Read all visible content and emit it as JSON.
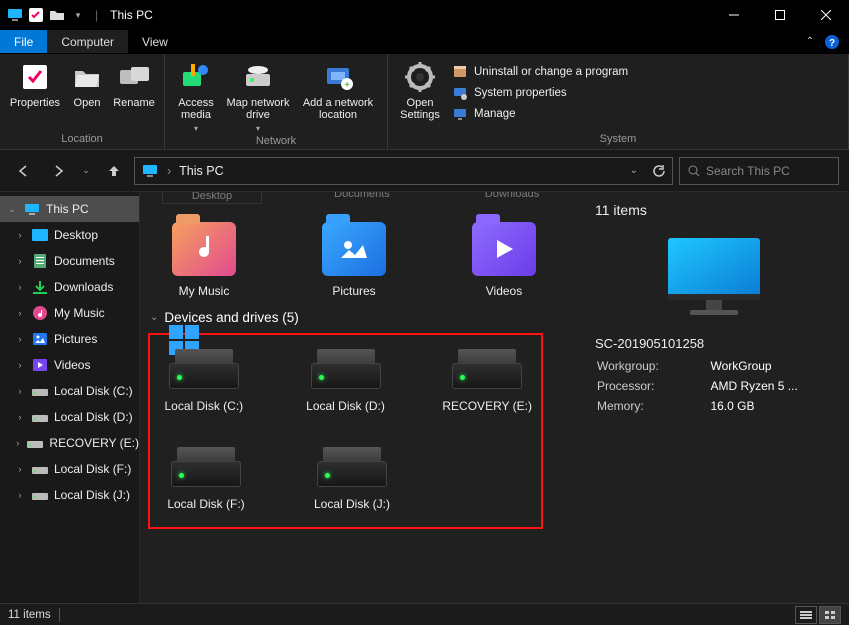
{
  "window": {
    "title": "This PC"
  },
  "menu": {
    "file": "File",
    "computer": "Computer",
    "view": "View"
  },
  "ribbon": {
    "location": {
      "label": "Location",
      "properties": "Properties",
      "open": "Open",
      "rename": "Rename"
    },
    "network": {
      "label": "Network",
      "access_media": "Access media",
      "map_drive": "Map network drive",
      "add_location": "Add a network location"
    },
    "system": {
      "label": "System",
      "open_settings": "Open Settings",
      "uninstall": "Uninstall or change a program",
      "sysprops": "System properties",
      "manage": "Manage"
    }
  },
  "address": {
    "path": "This PC",
    "sep": "›"
  },
  "search": {
    "placeholder": "Search This PC"
  },
  "sidebar": {
    "root": "This PC",
    "items": [
      "Desktop",
      "Documents",
      "Downloads",
      "My Music",
      "Pictures",
      "Videos",
      "Local Disk (C:)",
      "Local Disk (D:)",
      "RECOVERY (E:)",
      "Local Disk (F:)",
      "Local Disk (J:)"
    ]
  },
  "cutoff": [
    "Desktop",
    "Documents",
    "Downloads"
  ],
  "folders": [
    {
      "label": "My Music",
      "kind": "music"
    },
    {
      "label": "Pictures",
      "kind": "pics"
    },
    {
      "label": "Videos",
      "kind": "vids"
    }
  ],
  "drives_header": "Devices and drives (5)",
  "drives": [
    {
      "label": "Local Disk (C:)",
      "os": true
    },
    {
      "label": "Local Disk (D:)"
    },
    {
      "label": "RECOVERY (E:)"
    },
    {
      "label": "Local Disk (F:)"
    },
    {
      "label": "Local Disk (J:)"
    }
  ],
  "details": {
    "count_label": "11 items",
    "name": "SC-201905101258",
    "rows": [
      {
        "k": "Workgroup:",
        "v": "WorkGroup"
      },
      {
        "k": "Processor:",
        "v": "AMD Ryzen 5 ..."
      },
      {
        "k": "Memory:",
        "v": "16.0 GB"
      }
    ]
  },
  "status": {
    "text": "11 items"
  }
}
